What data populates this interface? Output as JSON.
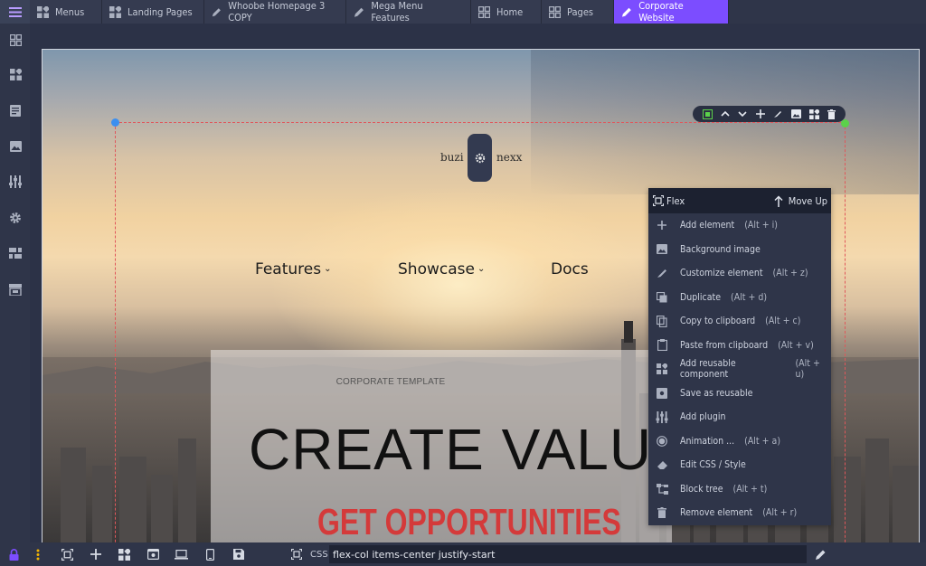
{
  "tabs": [
    {
      "label": "Menus",
      "icon": "blocks-icon"
    },
    {
      "label": "Landing Pages",
      "icon": "blocks-icon"
    },
    {
      "label": "Whoobe Homepage 3 COPY",
      "icon": "pencil-icon"
    },
    {
      "label": "Mega Menu Features",
      "icon": "pencil-icon"
    },
    {
      "label": "Home",
      "icon": "grid-icon"
    },
    {
      "label": "Pages",
      "icon": "grid-icon"
    },
    {
      "label": "Corporate Website",
      "icon": "pencil-icon",
      "active": true
    }
  ],
  "page": {
    "logo_left": "buzi",
    "logo_right": "nexx",
    "nav": [
      {
        "label": "Features",
        "has_dropdown": true
      },
      {
        "label": "Showcase",
        "has_dropdown": true
      },
      {
        "label": "Docs",
        "has_dropdown": false
      }
    ],
    "kicker": "CORPORATE TEMPLATE",
    "headline": "CREATE VALU",
    "subheadline": "GET OPPORTUNITIES"
  },
  "context_menu": {
    "title": "Flex",
    "move_up": "Move Up",
    "items": [
      {
        "label": "Add element",
        "shortcut": "(Alt + i)",
        "icon": "plus-icon"
      },
      {
        "label": "Background image",
        "shortcut": "",
        "icon": "image-icon"
      },
      {
        "label": "Customize element",
        "shortcut": "(Alt + z)",
        "icon": "brush-icon"
      },
      {
        "label": "Duplicate",
        "shortcut": "(Alt + d)",
        "icon": "duplicate-icon"
      },
      {
        "label": "Copy to clipboard",
        "shortcut": "(Alt + c)",
        "icon": "copy-icon"
      },
      {
        "label": "Paste from clipboard",
        "shortcut": "(Alt + v)",
        "icon": "paste-icon"
      },
      {
        "label": "Add reusable component",
        "shortcut": "(Alt + u)",
        "icon": "blocks-icon"
      },
      {
        "label": "Save as reusable",
        "shortcut": "",
        "icon": "save-icon"
      },
      {
        "label": "Add plugin",
        "shortcut": "",
        "icon": "plugin-icon"
      },
      {
        "label": "Animation ...",
        "shortcut": "(Alt + a)",
        "icon": "animation-icon"
      },
      {
        "label": "Edit CSS / Style",
        "shortcut": "",
        "icon": "eraser-icon"
      },
      {
        "label": "Block tree",
        "shortcut": "(Alt + t)",
        "icon": "tree-icon"
      },
      {
        "label": "Remove element",
        "shortcut": "(Alt + r)",
        "icon": "trash-icon"
      }
    ]
  },
  "bottombar": {
    "css_label": "CSS",
    "css_value": "flex-col items-center justify-start"
  },
  "colors": {
    "accent": "#7c4dff",
    "chrome": "#2f3549",
    "selection": "#e0575b",
    "subheadline": "#d43a3a"
  }
}
